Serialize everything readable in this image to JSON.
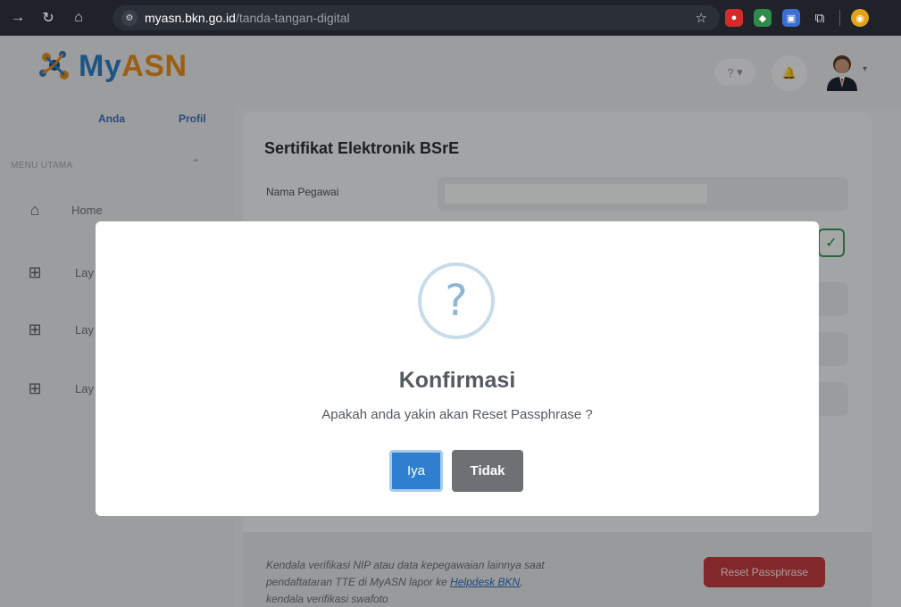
{
  "browser": {
    "url_host": "myasn.bkn.go.id",
    "url_path": "/tanda-tangan-digital",
    "icons": [
      "forward-icon",
      "reload-icon",
      "home-icon",
      "site-settings-icon",
      "bookmark-star-icon"
    ]
  },
  "header": {
    "logo_text_1": "My",
    "logo_text_2": "ASN",
    "help_label": "?",
    "bell_label": "🔔"
  },
  "sidebar": {
    "link_anda": "Anda",
    "link_profil": "Profil",
    "section_title": "MENU UTAMA",
    "items": [
      {
        "label": "Home",
        "icon": "house-icon"
      },
      {
        "label": "Lay",
        "icon": "grid-icon"
      },
      {
        "label": "Lay",
        "icon": "grid-icon"
      },
      {
        "label": "Lay",
        "icon": "grid-icon"
      }
    ]
  },
  "card": {
    "title": "Sertifikat Elektronik BSrE",
    "field_label": "Nama Pegawai",
    "footer_text_1": "Kendala verifikasi NIP atau data kepegawaian lainnya saat pendaftataran TTE di MyASN lapor ke ",
    "footer_link": "Helpdesk BKN",
    "footer_text_2": ", kendala verifikasi swafoto",
    "reset_label": "Reset Passphrase"
  },
  "modal": {
    "icon_glyph": "?",
    "title": "Konfirmasi",
    "message": "Apakah anda yakin akan Reset Passphrase ?",
    "confirm_label": "Iya",
    "cancel_label": "Tidak"
  },
  "colors": {
    "primary": "#2f7fd1",
    "danger": "#c13b3e",
    "neutral_button": "#6e7073",
    "brand_blue": "#2a7cc1",
    "brand_orange": "#e58d1c"
  }
}
